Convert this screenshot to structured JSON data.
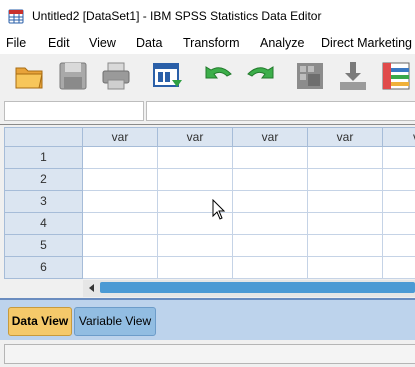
{
  "window": {
    "title": "Untitled2 [DataSet1] - IBM SPSS Statistics Data Editor"
  },
  "menu": [
    "File",
    "Edit",
    "View",
    "Data",
    "Transform",
    "Analyze",
    "Direct Marketing"
  ],
  "toolbar": {
    "icons": [
      "open-folder-icon",
      "save-icon",
      "print-icon",
      "recall-dialog-icon",
      "undo-icon",
      "redo-icon",
      "goto-case-icon",
      "goto-variable-icon",
      "variables-icon"
    ]
  },
  "cell_editor": {
    "reference": "",
    "value": ""
  },
  "grid": {
    "columns": [
      "var",
      "var",
      "var",
      "var",
      "va"
    ],
    "rows": [
      "1",
      "2",
      "3",
      "4",
      "5",
      "6"
    ]
  },
  "tabs": {
    "data_view": "Data View",
    "variable_view": "Variable View"
  },
  "status": {
    "text": ""
  },
  "colors": {
    "header_bg": "#dbe5f1",
    "active_tab": "#f5c96a",
    "inactive_tab": "#92bde2",
    "scroll_thumb": "#4c9ad4"
  }
}
